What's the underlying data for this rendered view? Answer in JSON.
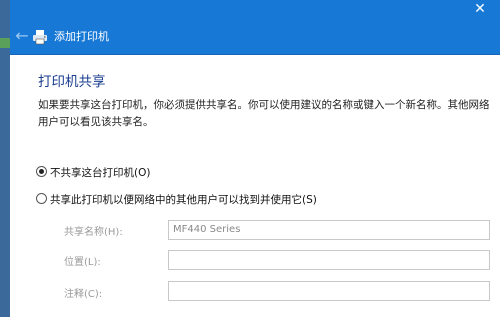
{
  "window": {
    "close_glyph": "✕"
  },
  "header": {
    "title": "添加打印机",
    "back_icon": "back-arrow-icon",
    "printer_icon": "printer-icon"
  },
  "main": {
    "heading": "打印机共享",
    "description": "如果要共享这台打印机，你必须提供共享名。你可以使用建议的名称或键入一个新名称。其他网络用户可以看见该共享名。",
    "options": [
      {
        "label": "不共享这台打印机(O)",
        "selected": true
      },
      {
        "label": "共享此打印机以便网络中的其他用户可以找到并使用它(S)",
        "selected": false
      }
    ],
    "fields": {
      "share_name": {
        "label": "共享名称(H):",
        "value": "MF440 Series"
      },
      "location": {
        "label": "位置(L):",
        "value": ""
      },
      "comment": {
        "label": "注释(C):",
        "value": ""
      }
    }
  },
  "colors": {
    "accent": "#1778d6",
    "heading": "#1a3d8f"
  }
}
